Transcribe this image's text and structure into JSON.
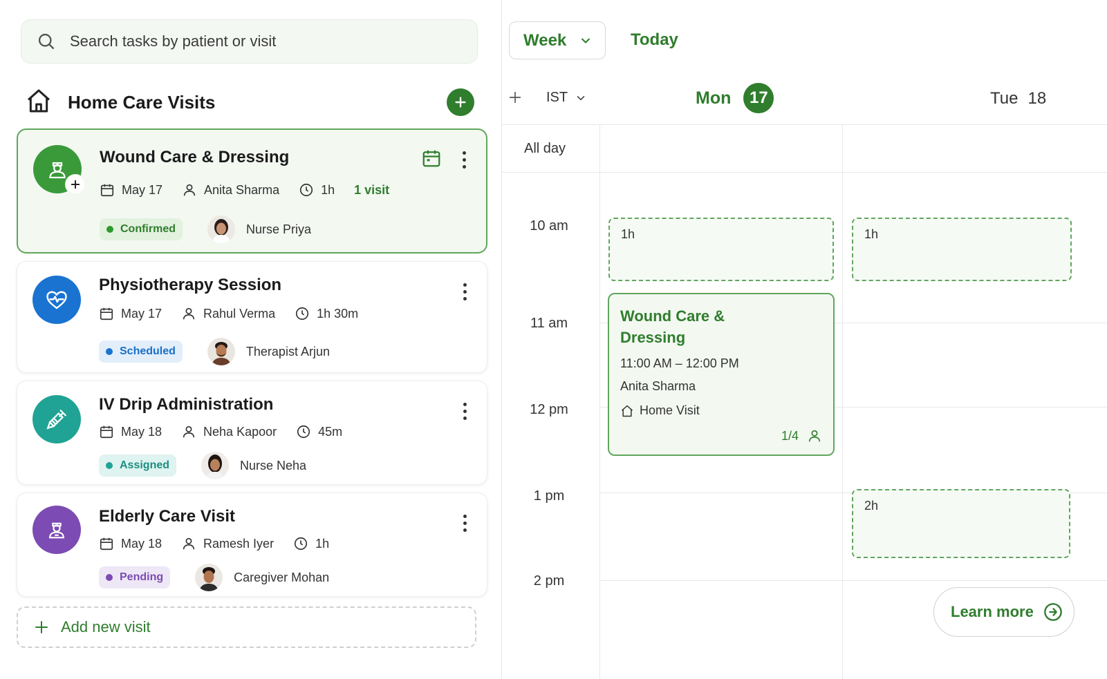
{
  "search": {
    "placeholder": "Search tasks by patient or visit"
  },
  "list": {
    "title": "Home Care Visits",
    "add_new_label": "Add new visit"
  },
  "visits": [
    {
      "title": "Wound Care & Dressing",
      "date": "May 17",
      "patient": "Anita Sharma",
      "duration": "1h",
      "visits": "1 visit",
      "status": "Confirmed",
      "caregiver": "Nurse Priya",
      "color": "#3a9a3a",
      "status_color": "#2f7d2d",
      "status_bg": "#e3f1df"
    },
    {
      "title": "Physiotherapy Session",
      "date": "May 17",
      "patient": "Rahul Verma",
      "duration": "1h 30m",
      "status": "Scheduled",
      "caregiver": "Therapist Arjun",
      "color": "#1a73d0",
      "status_color": "#1a6fc7",
      "status_bg": "#e3eefb"
    },
    {
      "title": "IV Drip Administration",
      "date": "May 18",
      "patient": "Neha Kapoor",
      "duration": "45m",
      "status": "Assigned",
      "caregiver": "Nurse Neha",
      "color": "#20a395",
      "status_color": "#1a8f82",
      "status_bg": "#dff3f0"
    },
    {
      "title": "Elderly Care Visit",
      "date": "May 18",
      "patient": "Ramesh Iyer",
      "duration": "1h",
      "status": "Pending",
      "caregiver": "Caregiver Mohan",
      "color": "#7c4bb3",
      "status_color": "#7c4bb3",
      "status_bg": "#eee7f6"
    }
  ],
  "calendar": {
    "view": "Week",
    "today_label": "Today",
    "timezone": "IST",
    "days": [
      {
        "name": "Mon",
        "num": "17"
      },
      {
        "name": "Tue",
        "num": "18"
      }
    ],
    "all_day_label": "All day",
    "hours": [
      "10 am",
      "11 am",
      "12 pm",
      "1 pm",
      "2 pm"
    ],
    "slots": {
      "mon_10": "1h",
      "tue_10": "1h",
      "tue_13": "2h"
    },
    "event": {
      "title": "Wound Care & Dressing",
      "time": "11:00 AM – 12:00 PM",
      "patient": "Anita Sharma",
      "location": "Home Visit",
      "count": "1/4"
    },
    "learn_more": "Learn more"
  },
  "colors": {
    "accent": "#2f7d2d"
  }
}
